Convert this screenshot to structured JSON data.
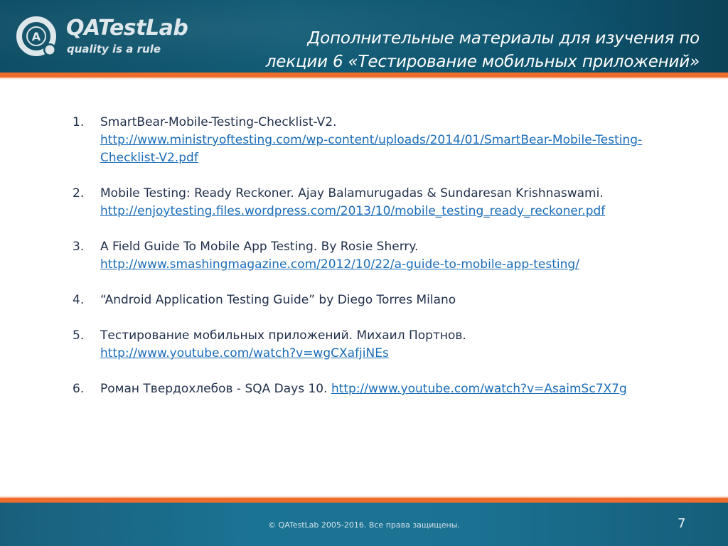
{
  "header": {
    "logo": {
      "icon": "qatestlab-at-icon",
      "name": "QATestLab",
      "tagline": "quality is a rule"
    },
    "title_lines": [
      "Дополнительные материалы для изучения по",
      "лекции 6 «Тестирование мобильных приложений»"
    ]
  },
  "colors": {
    "header_bg": "#135c76",
    "accent_orange": "#ee6c2c",
    "text": "#1f2f4a",
    "link": "#1a6cb8",
    "footer_bg": "#1b7394"
  },
  "items": [
    {
      "number": "1.",
      "text": "SmartBear-Mobile-Testing-Checklist-V2.",
      "link_lines": [
        "http://www.ministryoftesting.com/wp-content/uploads/2014/01/SmartBear-Mobile-Testing-",
        "Checklist-V2.pdf"
      ]
    },
    {
      "number": "2.",
      "text": "Mobile Testing: Ready Reckoner. Ajay Balamurugadas & Sundaresan Krishnaswami.",
      "link_lines": [
        "http://enjoytesting.files.wordpress.com/2013/10/mobile_testing_ready_reckoner.pdf"
      ]
    },
    {
      "number": "3.",
      "text": "A Field Guide To Mobile App Testing. By Rosie Sherry.",
      "link_lines": [
        "http://www.smashingmagazine.com/2012/10/22/a-guide-to-mobile-app-testing/"
      ]
    },
    {
      "number": "4.",
      "text": "“Android Application Testing Guide” by Diego Torres Milano",
      "link_lines": []
    },
    {
      "number": "5.",
      "text": "Тестирование мобильных приложений. Михаил Портнов.",
      "link_lines": [
        "http://www.youtube.com/watch?v=wgCXafjiNEs"
      ]
    },
    {
      "number": "6.",
      "text": "Роман Твердохлебов - SQA Days 10.",
      "inline_link": "http://www.youtube.com/watch?v=AsaimSc7X7g"
    }
  ],
  "footer": {
    "copyright": "© QATestLab 2005-2016. Все права защищены.",
    "page_number": "7"
  }
}
